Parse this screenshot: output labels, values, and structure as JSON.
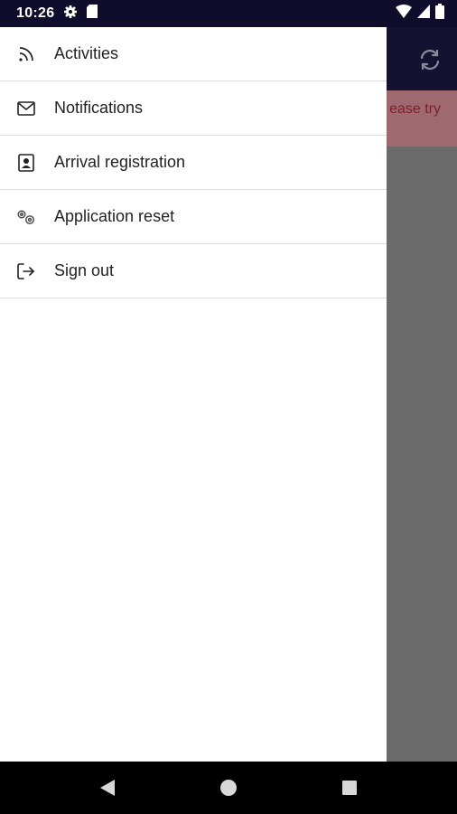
{
  "status_bar": {
    "time": "10:26",
    "icons": [
      "gear-icon",
      "sd-card-icon",
      "wifi-icon",
      "signal-icon",
      "battery-icon"
    ]
  },
  "background": {
    "error_text_fragment": "ease try",
    "refresh_icon": "refresh-icon",
    "colors": {
      "app_bar": "#141230",
      "banner": "#9f6a6f",
      "banner_text": "#7a1f2a",
      "scrim": "#6b6b6b"
    }
  },
  "drawer": {
    "items": [
      {
        "label": "Activities",
        "icon": "rss-icon"
      },
      {
        "label": "Notifications",
        "icon": "envelope-icon"
      },
      {
        "label": "Arrival registration",
        "icon": "contact-card-icon"
      },
      {
        "label": "Application reset",
        "icon": "gears-icon"
      },
      {
        "label": "Sign out",
        "icon": "sign-out-icon"
      }
    ]
  },
  "nav_bar": {
    "buttons": [
      "back-icon",
      "home-icon",
      "recents-icon"
    ]
  }
}
